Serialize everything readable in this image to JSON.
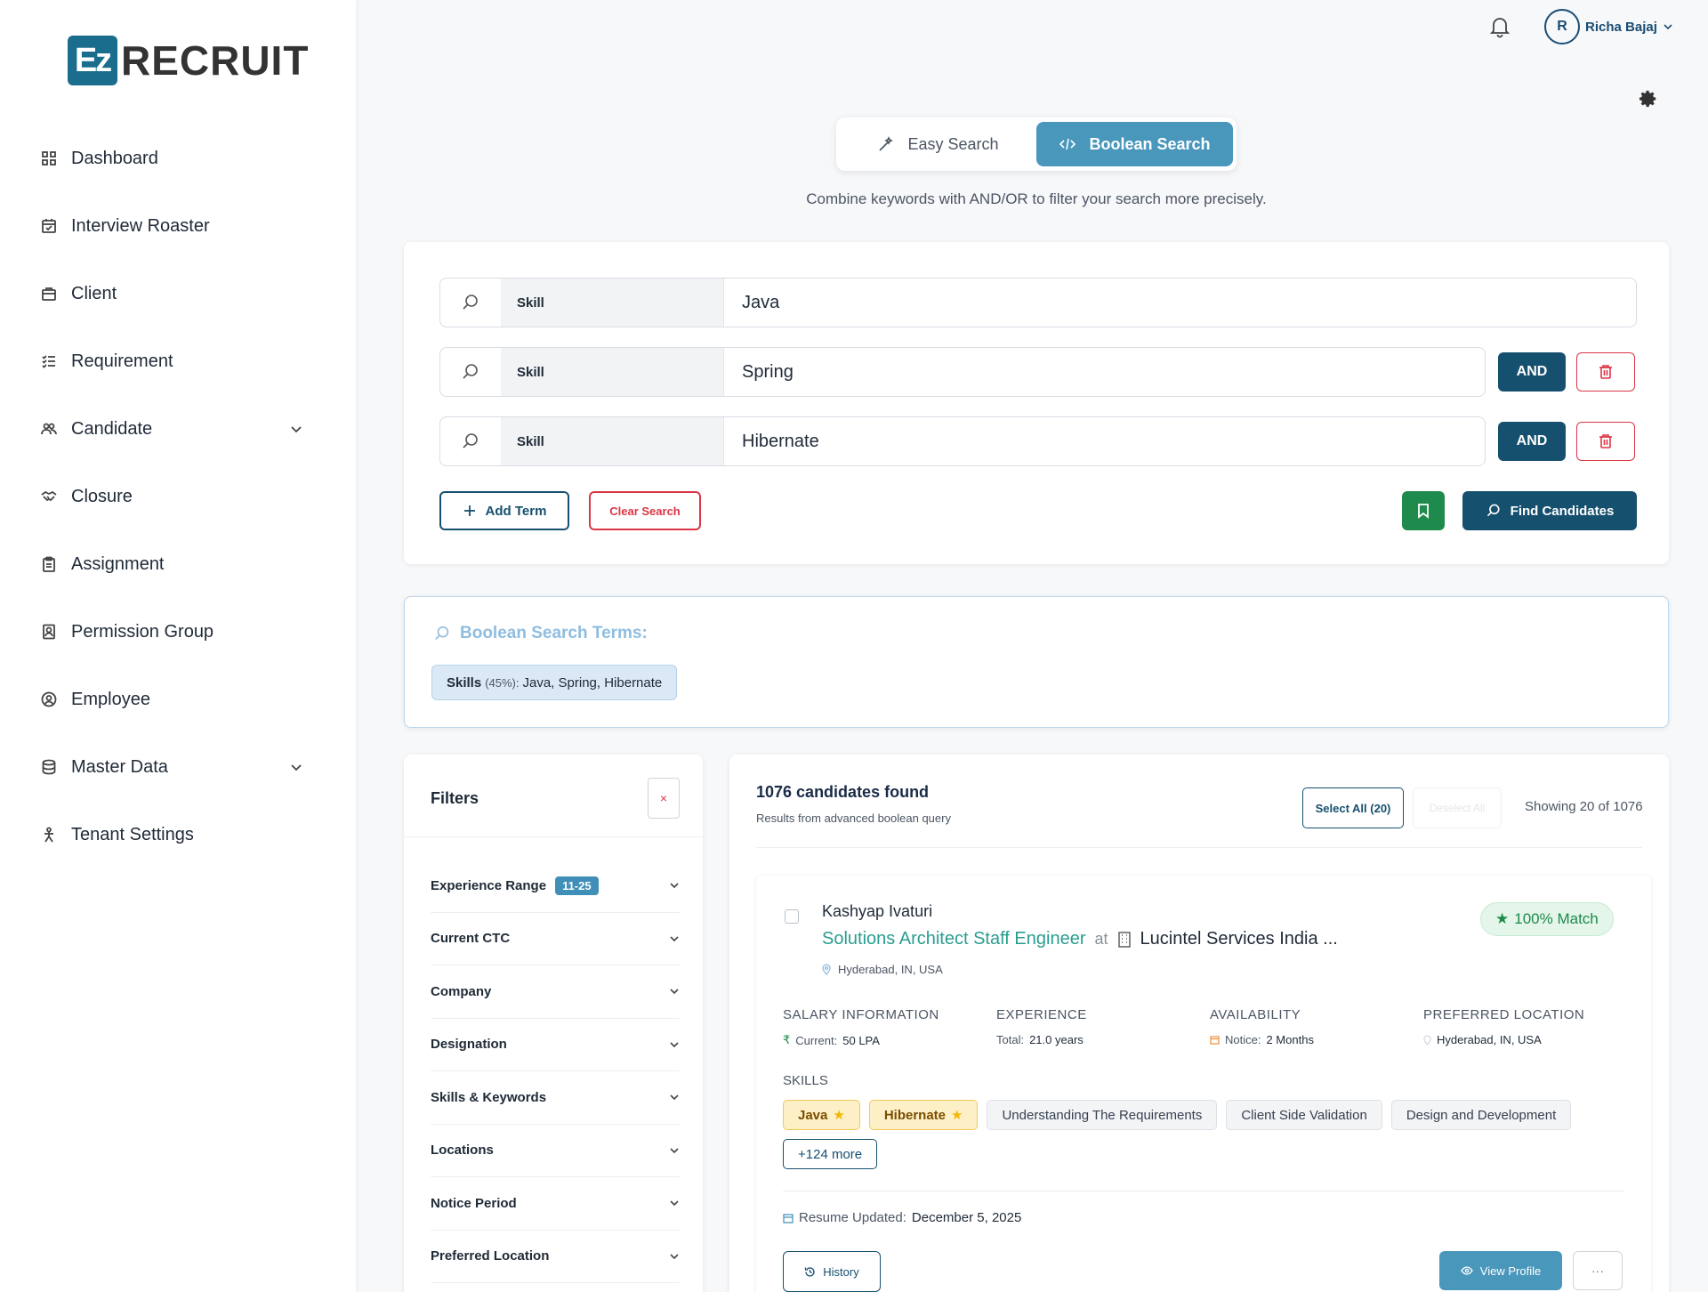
{
  "brand": {
    "logo_mark": "Ez",
    "logo_text": "RECRUIT"
  },
  "sidebar": {
    "items": [
      {
        "label": "Dashboard",
        "icon": "grid-icon"
      },
      {
        "label": "Interview Roaster",
        "icon": "calendar-icon"
      },
      {
        "label": "Client",
        "icon": "briefcase-icon"
      },
      {
        "label": "Requirement",
        "icon": "checklist-icon"
      },
      {
        "label": "Candidate",
        "icon": "users-icon",
        "expandable": true
      },
      {
        "label": "Closure",
        "icon": "handshake-icon"
      },
      {
        "label": "Assignment",
        "icon": "clipboard-icon"
      },
      {
        "label": "Permission Group",
        "icon": "badge-icon"
      },
      {
        "label": "Employee",
        "icon": "user-circle-icon"
      },
      {
        "label": "Master Data",
        "icon": "database-icon",
        "expandable": true
      },
      {
        "label": "Tenant Settings",
        "icon": "person-settings-icon"
      }
    ]
  },
  "header": {
    "user_initial": "R",
    "user_name": "Richa Bajaj"
  },
  "search_mode": {
    "easy_label": "Easy Search",
    "boolean_label": "Boolean Search",
    "active": "boolean",
    "subtitle": "Combine keywords with AND/OR to filter your search more precisely."
  },
  "terms": [
    {
      "field": "Skill",
      "value": "Java"
    },
    {
      "field": "Skill",
      "value": "Spring",
      "operator": "AND"
    },
    {
      "field": "Skill",
      "value": "Hibernate",
      "operator": "AND"
    }
  ],
  "actions": {
    "add_term": "Add Term",
    "clear_search": "Clear Search",
    "find_candidates": "Find Candidates"
  },
  "boolean_summary": {
    "title": "Boolean Search Terms:",
    "chip_label": "Skills",
    "chip_pct": "(45%):",
    "chip_values": "Java, Spring, Hibernate"
  },
  "filters": {
    "title": "Filters",
    "clear_icon": "×",
    "items": [
      {
        "label": "Experience Range",
        "badge": "11-25"
      },
      {
        "label": "Current CTC"
      },
      {
        "label": "Company"
      },
      {
        "label": "Designation"
      },
      {
        "label": "Skills & Keywords"
      },
      {
        "label": "Locations"
      },
      {
        "label": "Notice Period"
      },
      {
        "label": "Preferred Location"
      }
    ]
  },
  "results": {
    "count_text": "1076 candidates found",
    "subtitle": "Results from advanced boolean query",
    "select_all": "Select All (20)",
    "deselect_all": "Deselect All",
    "showing": "Showing 20 of 1076"
  },
  "candidate": {
    "name": "Kashyap Ivaturi",
    "role": "Solutions Architect Staff Engineer",
    "at": "at",
    "company": "Lucintel Services India ...",
    "location": "Hyderabad, IN, USA",
    "match": "100% Match",
    "salary": {
      "header": "SALARY INFORMATION",
      "key": "Current:",
      "value": "50 LPA"
    },
    "experience": {
      "header": "EXPERIENCE",
      "key": "Total:",
      "value": "21.0 years"
    },
    "availability": {
      "header": "AVAILABILITY",
      "key": "Notice:",
      "value": "2 Months"
    },
    "preferred": {
      "header": "PREFERRED LOCATION",
      "value": "Hyderabad, IN, USA"
    },
    "skills_header": "SKILLS",
    "skills_highlighted": [
      "Java",
      "Hibernate"
    ],
    "skills_other": [
      "Understanding The Requirements",
      "Client Side Validation",
      "Design and Development"
    ],
    "more_skills": "+124 more",
    "resume_key": "Resume Updated:",
    "resume_date": "December 5, 2025",
    "history": "History",
    "view_profile": "View Profile",
    "more_menu": "···"
  },
  "colors": {
    "primary": "#16506f",
    "accent": "#4a97bc",
    "danger": "#dc3545",
    "success": "#1e8a4c"
  }
}
